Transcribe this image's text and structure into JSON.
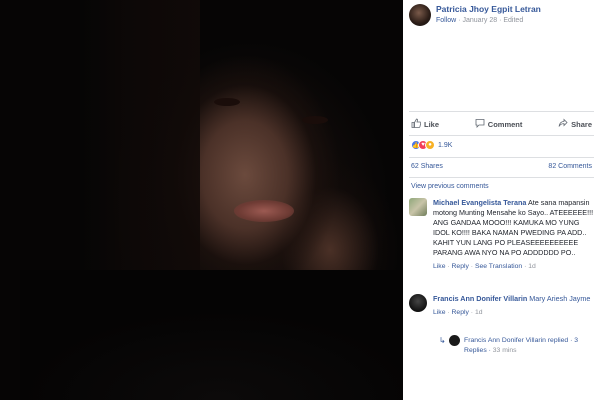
{
  "post": {
    "author": "Patricia Jhoy Egpit Letran",
    "follow_label": "Follow",
    "date": "January 28",
    "edited_label": "Edited",
    "separator": "·"
  },
  "actions": {
    "like_label": "Like",
    "comment_label": "Comment",
    "share_label": "Share"
  },
  "reactions": {
    "count": "1.9K",
    "types": [
      "like",
      "love",
      "wow"
    ]
  },
  "stats": {
    "shares": "62 Shares",
    "comments": "82 Comments"
  },
  "view_previous_comments": "View previous comments",
  "comments": [
    {
      "name": "Michael Evangelista Terana",
      "text": "Ate sana mapansin motong Munting Mensahe ko Sayo.. ATEEEEEE!!! ANG GANDAA MOOO!!! KAMUKA MO YUNG IDOL KO!!!! BAKA NAMAN PWEDING PA ADD.. KAHIT YUN LANG PO PLEASEEEEEEEEEE PARANG AWA NYO NA PO ADDDDDD PO..",
      "like_label": "Like",
      "reply_label": "Reply",
      "see_translation_label": "See Translation",
      "time": "1d"
    },
    {
      "name": "Francis Ann Donifer Villarin",
      "tag": "Mary Ariesh Jayme",
      "like_label": "Like",
      "reply_label": "Reply",
      "time": "1d"
    }
  ],
  "reply_summary": {
    "text": "Francis Ann Donifer Villarin replied · 3 Replies",
    "time": "33 mins"
  },
  "colors": {
    "link": "#365899",
    "muted": "#90949c",
    "like_reaction": "#4a76e8",
    "love_reaction": "#f33e58",
    "wow_reaction": "#f7b125"
  }
}
